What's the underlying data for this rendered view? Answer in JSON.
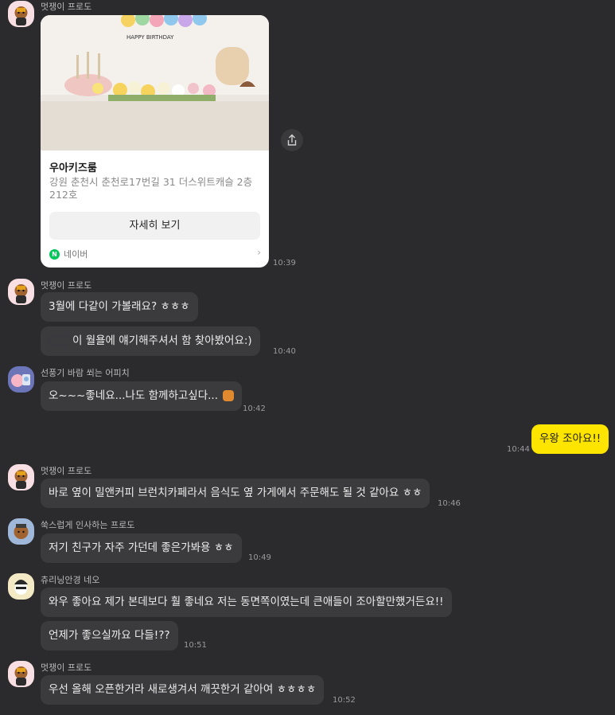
{
  "messages": {
    "m1": {
      "sender": "멋쟁이 프로도",
      "card": {
        "banner_text": "HAPPY BIRTHDAY",
        "title": "우아키즈룸",
        "address": "강원 춘천시 춘천로17번길 31 더스위트캐슬 2층 212호",
        "button": "자세히 보기",
        "source": "네이버",
        "source_icon": "N"
      },
      "time": "10:39"
    },
    "m2": {
      "sender": "멋쟁이 프로도",
      "line1": "3월에 다같이 가볼래요? ㅎㅎㅎ",
      "line2": "이 월욜에 얘기해주셔서 함 찾아봤어요:)",
      "time": "10:40"
    },
    "m3": {
      "sender": "선풍기 바람 쐬는 어피치",
      "text": "오~~~좋네요...나도 함께하고싶다...",
      "time": "10:42"
    },
    "m4": {
      "text": "우왕 조아요!!",
      "time": "10:44"
    },
    "m5": {
      "sender": "멋쟁이 프로도",
      "text": "바로 옆이 밀앤커피 브런치카페라서 음식도 옆 가게에서 주문해도 될 것 같아요 ㅎㅎ",
      "time": "10:46"
    },
    "m6": {
      "sender": "쑥스럽게 인사하는 프로도",
      "text": "저기 친구가 자주 가던데 좋은가봐용 ㅎㅎ",
      "time": "10:49"
    },
    "m7": {
      "sender": "츄리닝안경 네오",
      "line1": "와우 좋아요 제가 본데보다 훨 좋네요 저는 동면쪽이였는데 큰애들이 조아할만했거든요!!",
      "line2": "언제가 좋으실까요 다들!??",
      "time": "10:51"
    },
    "m8": {
      "sender": "멋쟁이 프로도",
      "text": "우선 올해 오픈한거라 새로생겨서 깨끗한거 같아여 ㅎㅎㅎㅎ",
      "time": "10:52"
    }
  },
  "colors": {
    "background": "#2b2b2d",
    "bubble_other": "#3b3b3e",
    "bubble_me": "#fee500",
    "naver_green": "#03c75a"
  }
}
